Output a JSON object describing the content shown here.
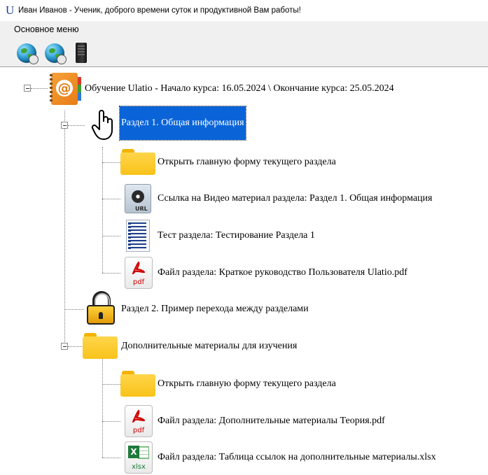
{
  "window": {
    "title_logo": "U",
    "title": "Иван Иванов - Ученик, доброго времени суток и продуктивной Вам работы!"
  },
  "menu": {
    "main_menu": "Основное меню"
  },
  "toolbar": {
    "buttons": [
      "globe-icon",
      "globe-icon",
      "server-icon"
    ]
  },
  "tree": {
    "root": "Обучение Ulatio - Начало курса: 16.05.2024 \\ Окончание курса: 25.05.2024",
    "section1": {
      "label": "Раздел 1. Общая информация",
      "items": [
        "Открыть главную форму текущего раздела",
        "Ссылка на Видео материал раздела: Раздел 1. Общая информация",
        "Тест раздела: Тестирование Раздела 1",
        "Файл раздела: Краткое руководство Пользователя Ulatio.pdf"
      ]
    },
    "section2": {
      "label": "Раздел 2. Пример перехода между разделами"
    },
    "extra": {
      "label": "Дополнительные материалы для изучения",
      "items": [
        "Открыть главную форму текущего раздела",
        "Файл раздела: Дополнительные материалы Теория.pdf",
        "Файл раздела: Таблица ссылок на дополнительные материалы.xlsx"
      ]
    }
  },
  "icons": {
    "video_label": "URL",
    "pdf_label": "pdf",
    "xlsx_label": "xlsx",
    "xlsx_badge": "X"
  },
  "colors": {
    "selection": "#0a64d8",
    "folder": "#f8c31a",
    "book": "#e87c14",
    "pdf": "#cc0000",
    "excel": "#1d7a3a"
  }
}
